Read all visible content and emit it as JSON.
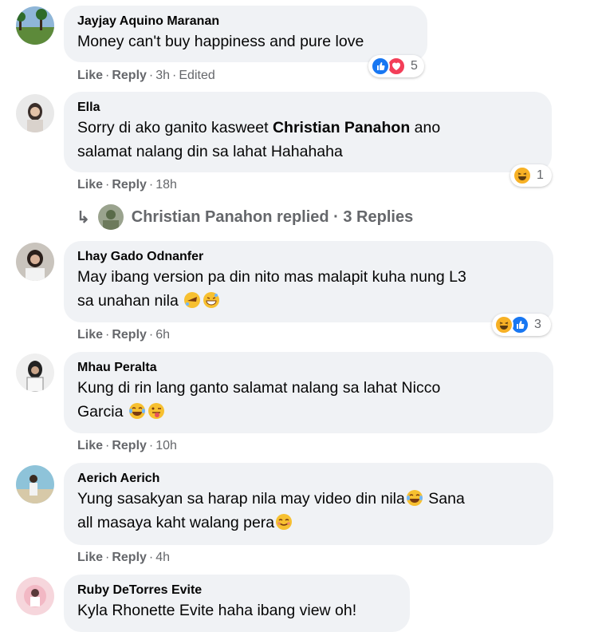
{
  "comments": [
    {
      "author": "Jayjay Aquino Maranan",
      "line1": "Money can't buy happiness and pure love",
      "like": "Like",
      "reply": "Reply",
      "time": "3h",
      "edited": "Edited",
      "reactions": {
        "icons": [
          "like-reaction-icon",
          "love-reaction-icon"
        ],
        "count": "5"
      }
    },
    {
      "author": "Ella",
      "line1_pre": "Sorry di ako ganito kasweet ",
      "line1_mention": "Christian Panahon",
      "line1_post": " ano",
      "line2": "salamat nalang din sa lahat Hahahaha",
      "like": "Like",
      "reply": "Reply",
      "time": "18h",
      "reactions": {
        "icons": [
          "haha-reaction-icon"
        ],
        "count": "1"
      },
      "replies": {
        "author": "Christian Panahon",
        "text": "replied · 3 Replies"
      }
    },
    {
      "author": "Lhay Gado Odnanfer",
      "line1": "May ibang version pa din nito mas malapit kuha nung L3",
      "line2": "sa unahan nila",
      "like": "Like",
      "reply": "Reply",
      "time": "6h",
      "reactions": {
        "icons": [
          "haha-reaction-icon",
          "like-reaction-icon"
        ],
        "count": "3"
      }
    },
    {
      "author": "Mhau Peralta",
      "line1": "Kung di rin lang ganto salamat nalang sa lahat Nicco",
      "line2": "Garcia",
      "like": "Like",
      "reply": "Reply",
      "time": "10h"
    },
    {
      "author": "Aerich Aerich",
      "line1": "Yung sasakyan sa harap nila may video din nila",
      "line1_post": " Sana",
      "line2": "all masaya kaht walang pera",
      "like": "Like",
      "reply": "Reply",
      "time": "4h"
    },
    {
      "author": "Ruby DeTorres Evite",
      "line1": "Kyla Rhonette Evite haha ibang view oh!"
    }
  ],
  "colors": {
    "bubble": "#f0f2f5",
    "meta": "#65676b",
    "like_blue": "#1877f2",
    "love_red": "#f33e58",
    "haha_yellow": "#f7b125"
  }
}
